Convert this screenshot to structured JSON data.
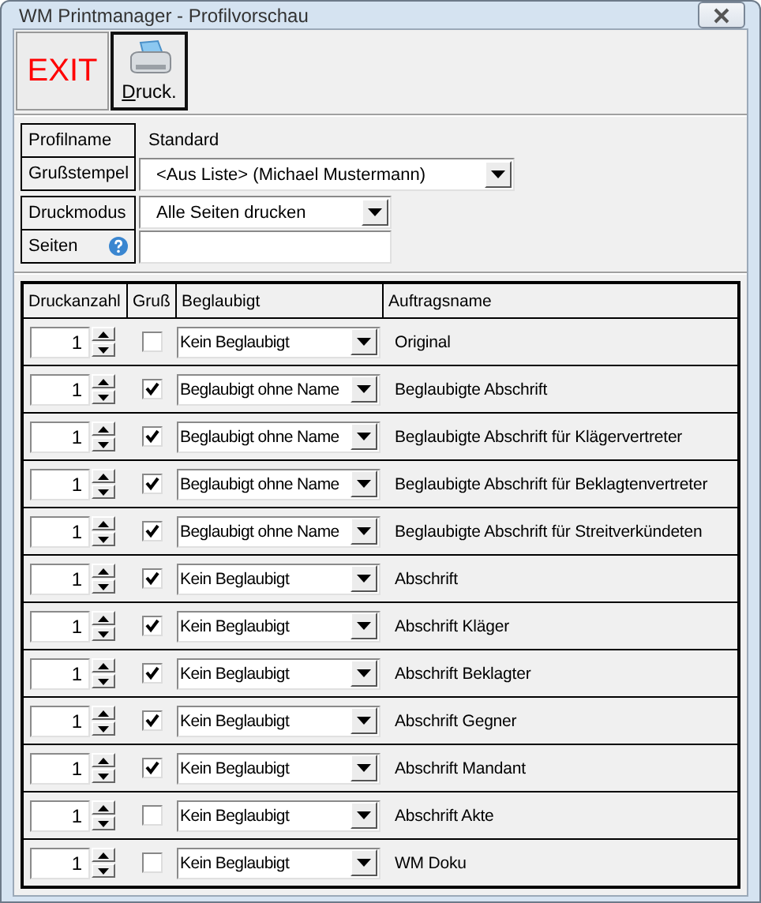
{
  "window": {
    "title": "WM Printmanager - Profilvorschau"
  },
  "toolbar": {
    "exit": "EXIT",
    "print": "Druck."
  },
  "profile": {
    "fields": [
      {
        "label": "Profilname",
        "kind": "text",
        "value": "Standard"
      },
      {
        "label": "Grußstempel",
        "kind": "combo",
        "value": "<Aus Liste> (Michael Mustermann)"
      }
    ]
  },
  "print": {
    "fields": [
      {
        "label": "Druckmodus",
        "kind": "combo",
        "value": "Alle Seiten drucken"
      },
      {
        "label": "Seiten",
        "kind": "input",
        "help": true
      }
    ]
  },
  "table": {
    "columns": [
      "Druckanzahl",
      "Gruß",
      "Beglaubigt",
      "Auftragsname"
    ],
    "rows": [
      {
        "count": "1",
        "checked": false,
        "certified": "Kein Beglaubigt",
        "name": "Original"
      },
      {
        "count": "1",
        "checked": true,
        "certified": "Beglaubigt ohne Name",
        "name": "Beglaubigte Abschrift"
      },
      {
        "count": "1",
        "checked": true,
        "certified": "Beglaubigt ohne Name",
        "name": "Beglaubigte Abschrift für Klägervertreter"
      },
      {
        "count": "1",
        "checked": true,
        "certified": "Beglaubigt ohne Name",
        "name": "Beglaubigte Abschrift für Beklagtenvertreter"
      },
      {
        "count": "1",
        "checked": true,
        "certified": "Beglaubigt ohne Name",
        "name": "Beglaubigte Abschrift für Streitverkündeten"
      },
      {
        "count": "1",
        "checked": true,
        "certified": "Kein Beglaubigt",
        "name": "Abschrift"
      },
      {
        "count": "1",
        "checked": true,
        "certified": "Kein Beglaubigt",
        "name": "Abschrift Kläger"
      },
      {
        "count": "1",
        "checked": true,
        "certified": "Kein Beglaubigt",
        "name": "Abschrift Beklagter"
      },
      {
        "count": "1",
        "checked": true,
        "certified": "Kein Beglaubigt",
        "name": "Abschrift Gegner"
      },
      {
        "count": "1",
        "checked": true,
        "certified": "Kein Beglaubigt",
        "name": "Abschrift Mandant"
      },
      {
        "count": "1",
        "checked": false,
        "certified": "Kein Beglaubigt",
        "name": "Abschrift Akte"
      },
      {
        "count": "1",
        "checked": false,
        "certified": "Kein Beglaubigt",
        "name": "WM Doku"
      }
    ]
  }
}
